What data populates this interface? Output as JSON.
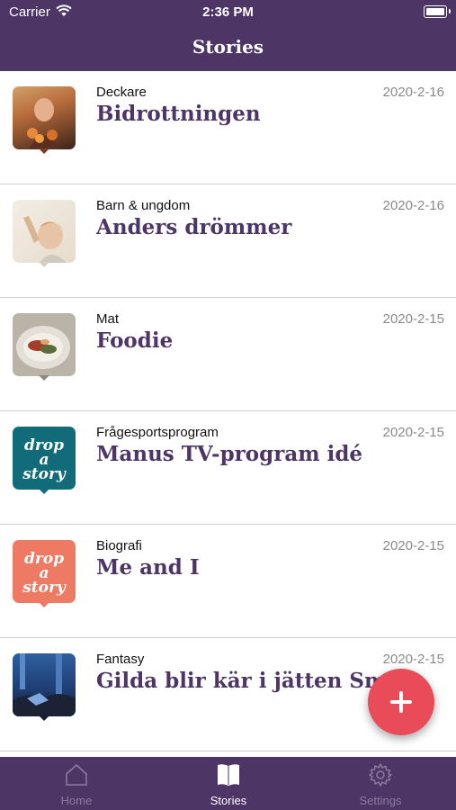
{
  "status_bar": {
    "carrier": "Carrier",
    "time": "2:36 PM"
  },
  "header": {
    "title": "Stories"
  },
  "stories": [
    {
      "category": "Deckare",
      "title": "Bidrottningen",
      "date": "2020-2-16",
      "thumb": "photo-woman-flowers"
    },
    {
      "category": "Barn & ungdom",
      "title": "Anders drömmer",
      "date": "2020-2-16",
      "thumb": "photo-child"
    },
    {
      "category": "Mat",
      "title": "Foodie",
      "date": "2020-2-15",
      "thumb": "photo-food"
    },
    {
      "category": "Frågesportsprogram",
      "title": "Manus TV-program idé",
      "date": "2020-2-15",
      "thumb": "drop-a-story-logo-teal"
    },
    {
      "category": "Biografi",
      "title": "Me and I",
      "date": "2020-2-15",
      "thumb": "drop-a-story-logo-coral"
    },
    {
      "category": "Fantasy",
      "title": "Gilda blir kär i jätten Small",
      "date": "2020-2-15",
      "thumb": "photo-fantasy-forest"
    }
  ],
  "logo": {
    "line1": "drop",
    "line2": "a",
    "line3": "story"
  },
  "fab": {
    "icon": "plus-icon",
    "color": "#e94b59"
  },
  "tabs": [
    {
      "label": "Home",
      "icon": "home-icon"
    },
    {
      "label": "Stories",
      "icon": "book-icon"
    },
    {
      "label": "Settings",
      "icon": "gear-icon"
    }
  ],
  "colors": {
    "brand": "#4d3566",
    "accent": "#e94b59",
    "teal": "#126b78",
    "coral": "#ee7a64"
  }
}
